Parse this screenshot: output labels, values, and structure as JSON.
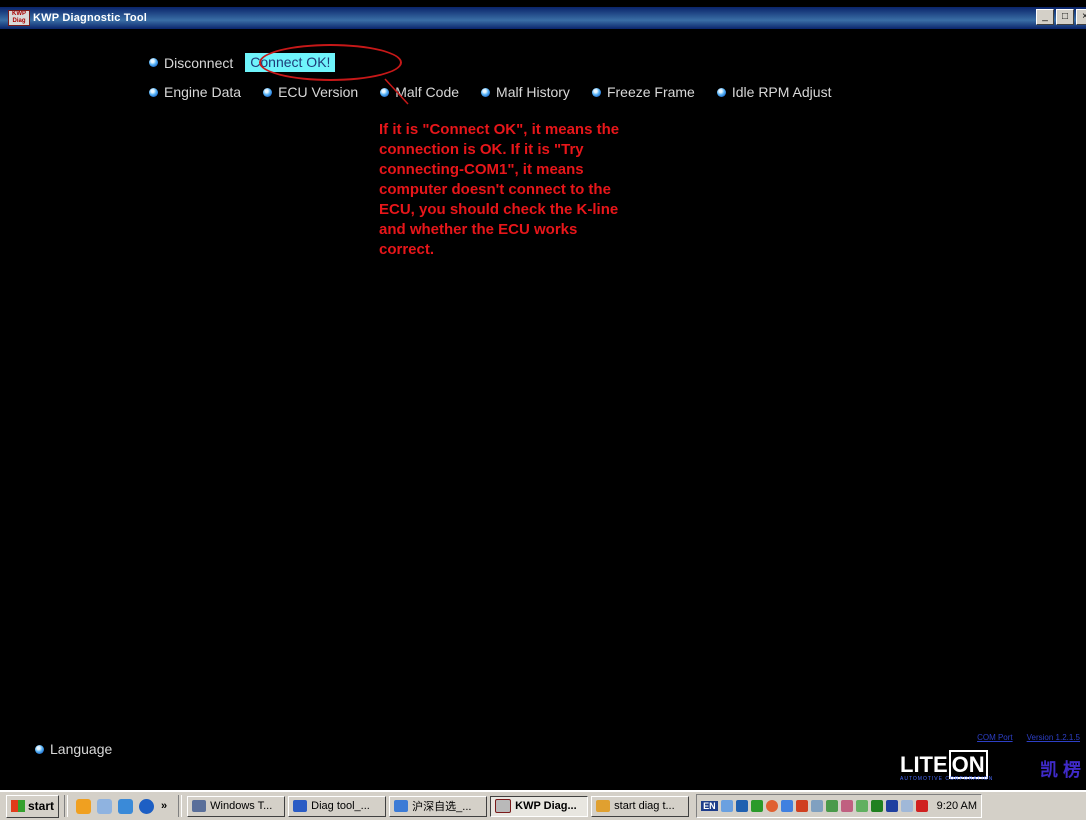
{
  "window": {
    "app_icon_text": "KWP Diag",
    "title": "KWP Diagnostic Tool",
    "controls": [
      "_",
      "□",
      "×"
    ]
  },
  "menu": {
    "disconnect_label": "Disconnect",
    "status_label": "Connect OK!",
    "functions": [
      "Engine Data",
      "ECU Version",
      "Malf Code",
      "Malf History",
      "Freeze Frame",
      "Idle RPM Adjust"
    ]
  },
  "annotation": {
    "color": "#e8161a",
    "lines": [
      "If it is \"Connect OK\", it means the",
      "connection is OK. If it is \"Try",
      "connecting-COM1\", it means",
      "computer doesn't connect to the",
      "ECU, you should check the K-line",
      "and whether the ECU works",
      "correct."
    ]
  },
  "language_label": "Language",
  "footer": {
    "com_link": "COM Port",
    "version_link": "Version 1.2.1.5",
    "logo_text_a": "LITE",
    "logo_text_b": "ON",
    "logo_sub": "AUTOMOTIVE CORPORATION",
    "logo_cn": "凯 楞 科 技"
  },
  "taskbar": {
    "start_label": "start",
    "chevron": "»",
    "buttons": [
      {
        "label": "Windows T...",
        "icon": "windows-task-icon",
        "active": false
      },
      {
        "label": "Diag tool_...",
        "icon": "word-doc-icon",
        "active": false
      },
      {
        "label": "沪深自选_...",
        "icon": "browser-icon",
        "active": false
      },
      {
        "label": "KWP Diag...",
        "icon": "kwp-app-icon",
        "active": true
      },
      {
        "label": "start diag t...",
        "icon": "paint-icon",
        "active": false
      }
    ],
    "tray_lang": "EN",
    "clock": "9:20 AM"
  },
  "colors": {
    "status_bg": "#6ff4fb",
    "annotation_red": "#e8161a",
    "titlebar_blue": "#0a246a"
  }
}
